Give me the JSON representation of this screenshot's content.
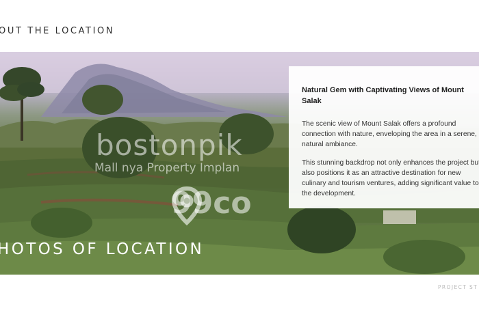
{
  "header": {
    "title": "OUT THE LOCATION"
  },
  "hero": {
    "watermarks": {
      "brand": "bostonpik",
      "tagline": "Mall nya Property Implan",
      "site": "99co"
    }
  },
  "info_card": {
    "title": "Natural Gem with Captivating Views of Mount Salak",
    "paragraph_1": "The scenic view of Mount Salak offers a profound connection with nature, enveloping the area in a serene, natural ambiance.",
    "paragraph_2": "This stunning backdrop not only enhances the project but also positions it as an attractive destination for new culinary and tourism ventures, adding significant value to the development."
  },
  "section": {
    "title": "HOTOS OF LOCATION"
  },
  "footer": {
    "label": "PROJECT ST"
  },
  "colors": {
    "text_dark": "#2f2f2f",
    "card_bg": "#ffffff",
    "section_title": "#ffffff",
    "footer": "#b9b9b9"
  }
}
